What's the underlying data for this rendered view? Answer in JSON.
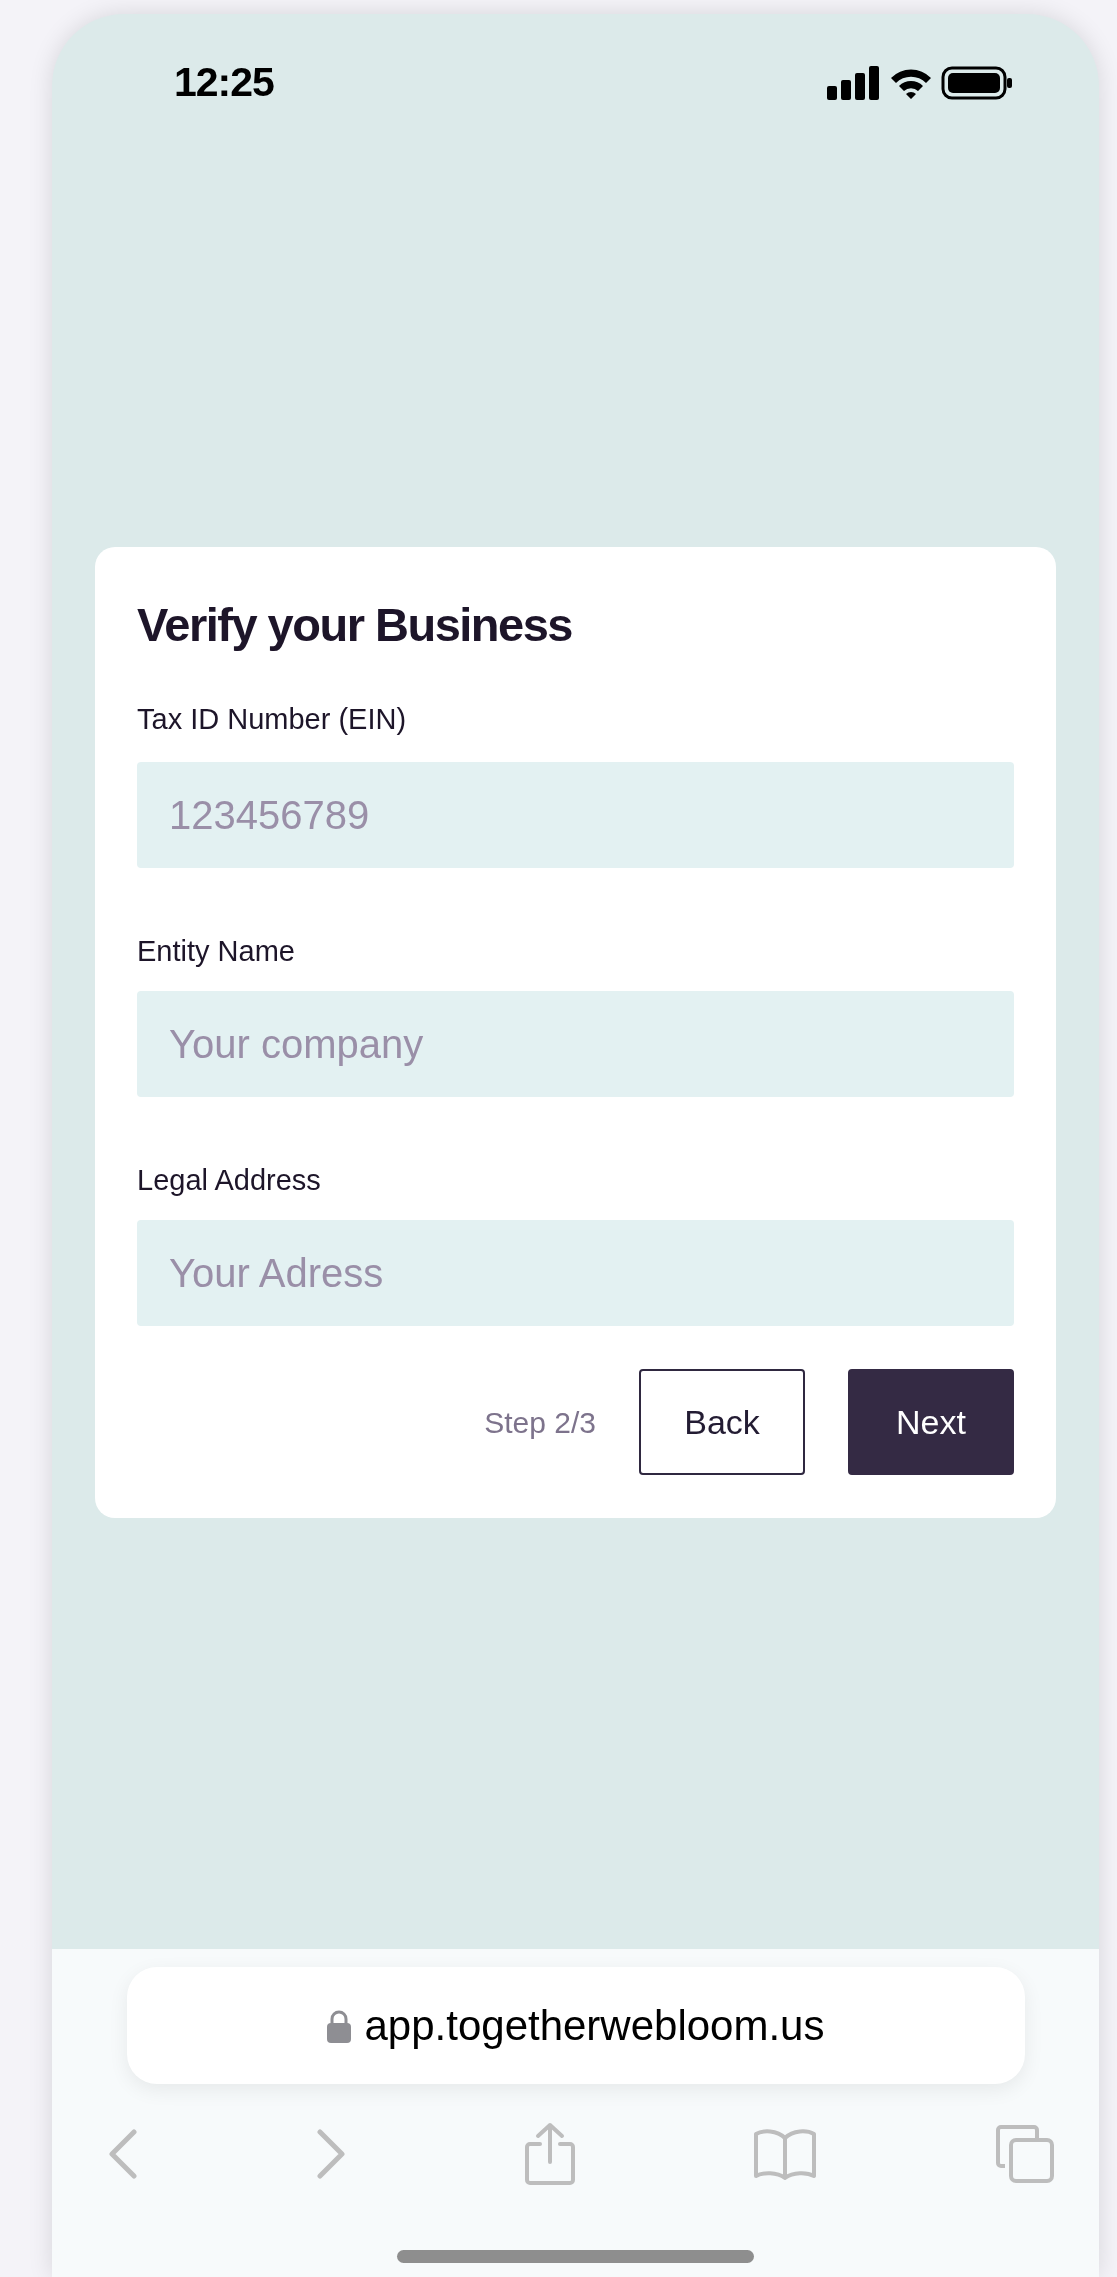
{
  "status_bar": {
    "time": "12:25"
  },
  "form": {
    "title": "Verify your Business",
    "fields": [
      {
        "label": "Tax ID Number (EIN)",
        "placeholder": "123456789"
      },
      {
        "label": "Entity Name",
        "placeholder": "Your company"
      },
      {
        "label": "Legal Address",
        "placeholder": "Your Adress"
      }
    ],
    "step": "Step 2/3",
    "buttons": [
      {
        "label": "Back",
        "kind": "secondary"
      },
      {
        "label": "Next",
        "kind": "primary"
      }
    ]
  },
  "browser": {
    "url": "app.togetherwebloom.us"
  }
}
